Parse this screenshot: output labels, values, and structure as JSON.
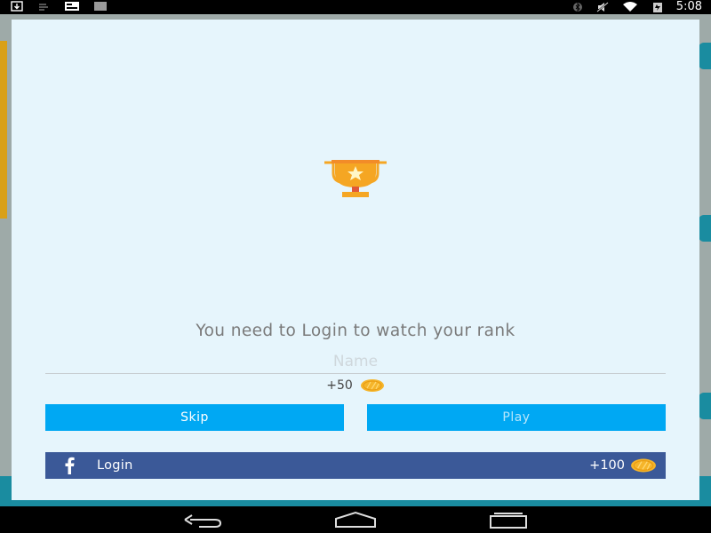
{
  "status_bar": {
    "time": "5:08",
    "left_icons": [
      "download-icon",
      "cast-icon",
      "notification-card-icon",
      "barcode-icon"
    ],
    "right_icons": [
      "bluetooth-icon",
      "mute-icon",
      "wifi-icon",
      "battery-icon"
    ]
  },
  "dialog": {
    "icon": "trophy-icon",
    "message": "You need to Login to watch your rank",
    "name_input": {
      "placeholder": "Name",
      "value": ""
    },
    "bonus": "+50",
    "skip_label": "Skip",
    "play_label": "Play",
    "facebook": {
      "label": "Login",
      "bonus": "+100"
    }
  },
  "nav_bar": {
    "items": [
      "back-icon",
      "home-icon",
      "recents-icon"
    ]
  },
  "colors": {
    "dialog_bg": "#e6f5fc",
    "button_blue": "#00a8f3",
    "facebook_blue": "#3b5998",
    "coin": "#f5b52a",
    "trophy": "#f5a623"
  }
}
